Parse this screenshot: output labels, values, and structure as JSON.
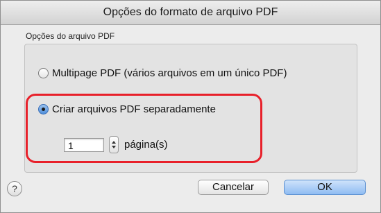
{
  "window": {
    "title": "Opções do formato de arquivo PDF"
  },
  "group": {
    "label": "Opções do arquivo PDF"
  },
  "options": [
    {
      "label": "Multipage PDF (vários arquivos em um único PDF)",
      "checked": false
    },
    {
      "label": "Criar arquivos PDF separadamente",
      "checked": true
    }
  ],
  "pages": {
    "value": "1",
    "unit_label": "página(s)"
  },
  "help": {
    "glyph": "?"
  },
  "buttons": {
    "cancel": "Cancelar",
    "ok": "OK"
  },
  "colors": {
    "highlight": "#e8202a",
    "default_button": "#8fbcf2"
  }
}
